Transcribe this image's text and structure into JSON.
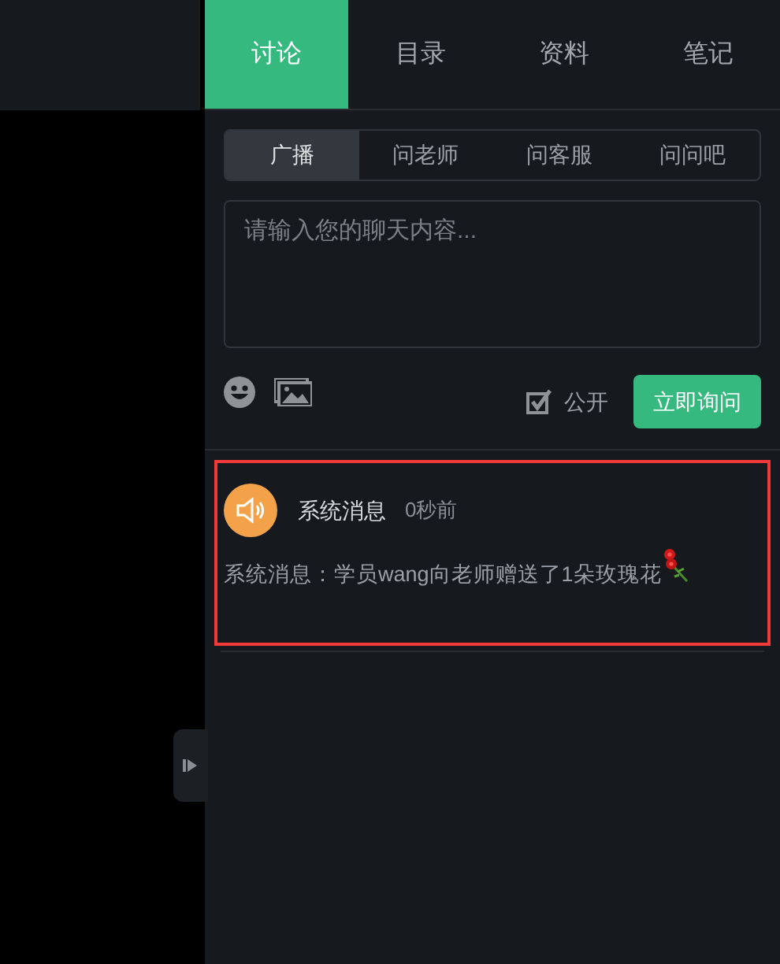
{
  "tabs": [
    {
      "label": "讨论",
      "selected": true
    },
    {
      "label": "目录",
      "selected": false
    },
    {
      "label": "资料",
      "selected": false
    },
    {
      "label": "笔记",
      "selected": false
    }
  ],
  "sub_tabs": [
    {
      "label": "广播",
      "selected": true
    },
    {
      "label": "问老师",
      "selected": false
    },
    {
      "label": "问客服",
      "selected": false
    },
    {
      "label": "问问吧",
      "selected": false
    }
  ],
  "chat_input": {
    "placeholder": "请输入您的聊天内容..."
  },
  "public_option": {
    "label": "公开",
    "checked": true
  },
  "send_button": "立即询问",
  "messages": [
    {
      "sender": "系统消息",
      "time": "0秒前",
      "text": "系统消息：学员wang向老师赠送了1朵玫瑰花"
    }
  ]
}
